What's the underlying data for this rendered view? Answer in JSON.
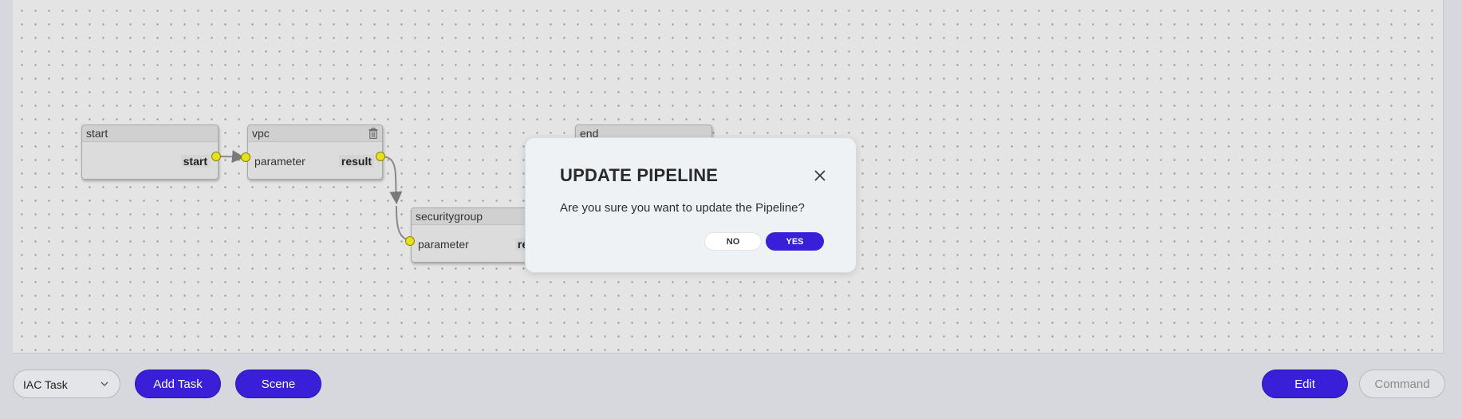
{
  "canvas": {
    "nodes": [
      {
        "title": "start",
        "input": "",
        "output": "start"
      },
      {
        "title": "vpc",
        "input": "parameter",
        "output": "result"
      },
      {
        "title": "securitygroup",
        "input": "parameter",
        "output": "result"
      },
      {
        "title": "end",
        "input": "",
        "output": ""
      }
    ]
  },
  "toolbar": {
    "task_type": "IAC Task",
    "add_task": "Add Task",
    "scene": "Scene",
    "edit": "Edit",
    "command": "Command"
  },
  "dialog": {
    "title": "UPDATE PIPELINE",
    "message": "Are you sure you want to update the Pipeline?",
    "no": "NO",
    "yes": "YES"
  },
  "colors": {
    "accent": "#3a1fd8",
    "port": "#e6e118"
  }
}
